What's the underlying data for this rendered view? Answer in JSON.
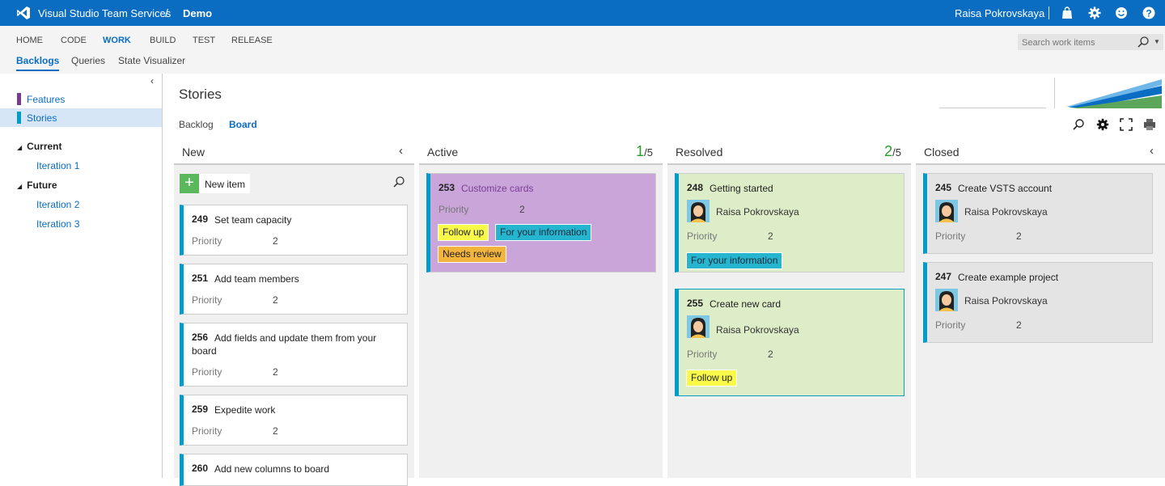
{
  "header": {
    "brand": "Visual Studio Team Services",
    "separator": "/",
    "project": "Demo",
    "user": "Raisa Pokrovskaya",
    "icons": [
      "shopping-bag-icon",
      "gear-icon",
      "smiley-icon",
      "help-icon"
    ]
  },
  "nav": {
    "hubs": [
      "HOME",
      "CODE",
      "WORK",
      "BUILD",
      "TEST",
      "RELEASE"
    ],
    "active_hub": "WORK",
    "subhubs": [
      "Backlogs",
      "Queries",
      "State Visualizer"
    ],
    "active_subhub": "Backlogs",
    "search_placeholder": "Search work items"
  },
  "sidebar": {
    "collapse_glyph": "‹",
    "backlogs": [
      {
        "label": "Features",
        "color": "#773b93"
      },
      {
        "label": "Stories",
        "color": "#009ccc",
        "selected": true
      }
    ],
    "groups": [
      {
        "label": "Current",
        "iterations": [
          "Iteration 1"
        ]
      },
      {
        "label": "Future",
        "iterations": [
          "Iteration 2",
          "Iteration 3"
        ]
      }
    ]
  },
  "main": {
    "title": "Stories",
    "tabs": [
      "Backlog",
      "Board"
    ],
    "active_tab": "Board"
  },
  "board": {
    "new_item_label": "New item",
    "columns": [
      {
        "name": "New",
        "wip": null
      },
      {
        "name": "Active",
        "wip": {
          "count": "1",
          "limit": "/5"
        }
      },
      {
        "name": "Resolved",
        "wip": {
          "count": "2",
          "limit": "/5"
        }
      },
      {
        "name": "Closed",
        "wip": null
      }
    ],
    "cards": {
      "new": [
        {
          "id": "249",
          "title": "Set team capacity",
          "field": "Priority",
          "value": "2"
        },
        {
          "id": "251",
          "title": "Add team members",
          "field": "Priority",
          "value": "2"
        },
        {
          "id": "256",
          "title": "Add fields and update them from your board",
          "field": "Priority",
          "value": "2"
        },
        {
          "id": "259",
          "title": "Expedite work",
          "field": "Priority",
          "value": "2"
        },
        {
          "id": "260",
          "title": "Add new columns to board"
        }
      ],
      "active": [
        {
          "id": "253",
          "title": "Customize cards",
          "field": "Priority",
          "value": "2",
          "tags": [
            "Follow up",
            "For your information",
            "Needs review"
          ],
          "color": "#c9a5da"
        }
      ],
      "resolved": [
        {
          "id": "248",
          "title": "Getting started",
          "assigned": "Raisa Pokrovskaya",
          "field": "Priority",
          "value": "2",
          "tags": [
            "For your information"
          ],
          "color": "#dcedc8"
        },
        {
          "id": "255",
          "title": "Create new card",
          "assigned": "Raisa Pokrovskaya",
          "field": "Priority",
          "value": "2",
          "tags": [
            "Follow up"
          ],
          "color": "#dcedc8"
        }
      ],
      "closed": [
        {
          "id": "245",
          "title": "Create VSTS account",
          "assigned": "Raisa Pokrovskaya",
          "field": "Priority",
          "value": "2",
          "color": "#e4e4e4"
        },
        {
          "id": "247",
          "title": "Create example project",
          "assigned": "Raisa Pokrovskaya",
          "field": "Priority",
          "value": "2",
          "color": "#e4e4e4"
        }
      ]
    }
  },
  "colors": {
    "brand_blue": "#0a6dc2",
    "story_blue": "#009ccc",
    "feature_purple": "#773b93",
    "tag_yellow": "#f9f94a",
    "tag_teal": "#25b5cf",
    "tag_orange": "#f3b43c"
  }
}
